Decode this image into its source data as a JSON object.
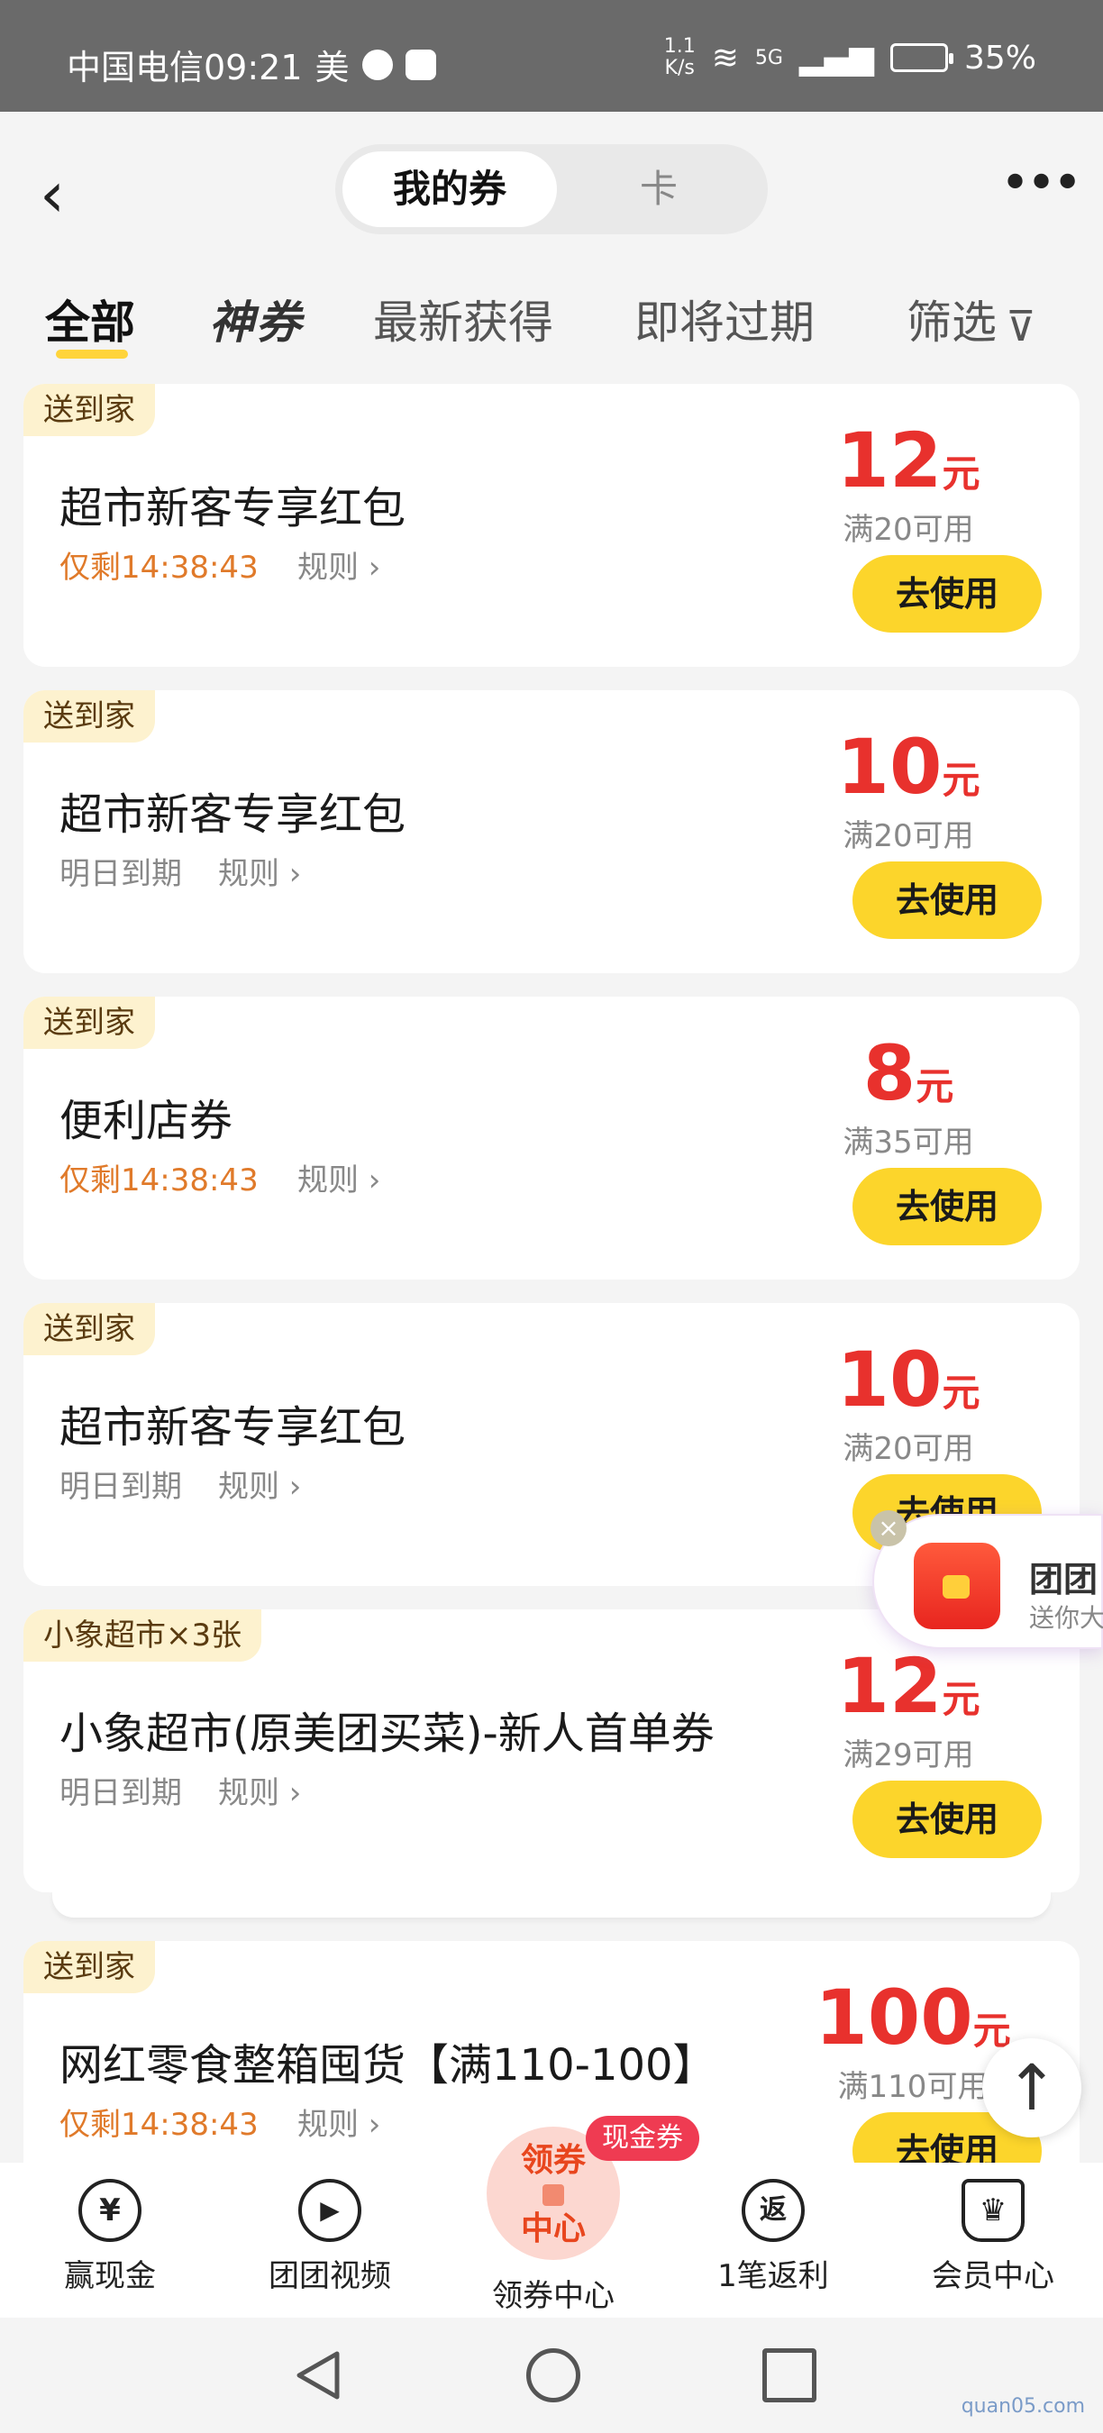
{
  "status_bar": {
    "carrier_time": "中国电信09:21",
    "app_mark": "美",
    "net_speed_value": "1.1",
    "net_speed_unit": "K/s",
    "network": "5G",
    "battery": "35%"
  },
  "header": {
    "back_icon": "chevron-left-icon",
    "segment": {
      "active": "我的券",
      "inactive": "卡"
    },
    "more_icon": "more-dots-icon"
  },
  "tabs": {
    "all": "全部",
    "shen": "神券",
    "newest": "最新获得",
    "expiring": "即将过期",
    "filter": "筛选",
    "filter_icon": "funnel-icon"
  },
  "coupons": [
    {
      "tag": "送到家",
      "title": "超市新客专享红包",
      "expiry": "仅剩14:38:43",
      "expiry_style": "urgent",
      "rules": "规则",
      "amount": "12",
      "unit": "元",
      "condition": "满20可用",
      "button": "去使用"
    },
    {
      "tag": "送到家",
      "title": "超市新客专享红包",
      "expiry": "明日到期",
      "expiry_style": "normal",
      "rules": "规则",
      "amount": "10",
      "unit": "元",
      "condition": "满20可用",
      "button": "去使用"
    },
    {
      "tag": "送到家",
      "title": "便利店券",
      "expiry": "仅剩14:38:43",
      "expiry_style": "urgent",
      "rules": "规则",
      "amount": "8",
      "unit": "元",
      "condition": "满35可用",
      "button": "去使用"
    },
    {
      "tag": "送到家",
      "title": "超市新客专享红包",
      "expiry": "明日到期",
      "expiry_style": "normal",
      "rules": "规则",
      "amount": "10",
      "unit": "元",
      "condition": "满20可用",
      "button": "去使用"
    },
    {
      "tag": "小象超市×3张",
      "title": "小象超市(原美团买菜)-新人首单券",
      "expiry": "明日到期",
      "expiry_style": "normal",
      "rules": "规则",
      "amount": "12",
      "unit": "元",
      "condition": "满29可用",
      "button": "去使用"
    },
    {
      "tag": "送到家",
      "title": "网红零食整箱囤货【满110-100】",
      "expiry": "仅剩14:38:43",
      "expiry_style": "urgent",
      "rules": "规则",
      "amount": "100",
      "unit": "元",
      "condition": "满110可用",
      "button": "去使用"
    }
  ],
  "float_promo": {
    "title": "团团",
    "subtitle": "送你大",
    "close_icon": "close-icon"
  },
  "to_top_icon": "arrow-up-icon",
  "bottom_nav": {
    "win_cash": {
      "label": "赢现金",
      "icon": "yen-icon",
      "glyph": "¥"
    },
    "video": {
      "label": "团团视频",
      "icon": "play-icon",
      "glyph": "▶"
    },
    "coupon_center": {
      "label": "领券中心",
      "ball_top": "领券",
      "ball_bottom": "中心",
      "badge": "现金券"
    },
    "rebate": {
      "label": "1笔返利",
      "icon": "rebate-icon",
      "glyph": "返"
    },
    "member": {
      "label": "会员中心",
      "icon": "crown-icon",
      "glyph": "♛"
    }
  },
  "watermark": "quan05.com"
}
